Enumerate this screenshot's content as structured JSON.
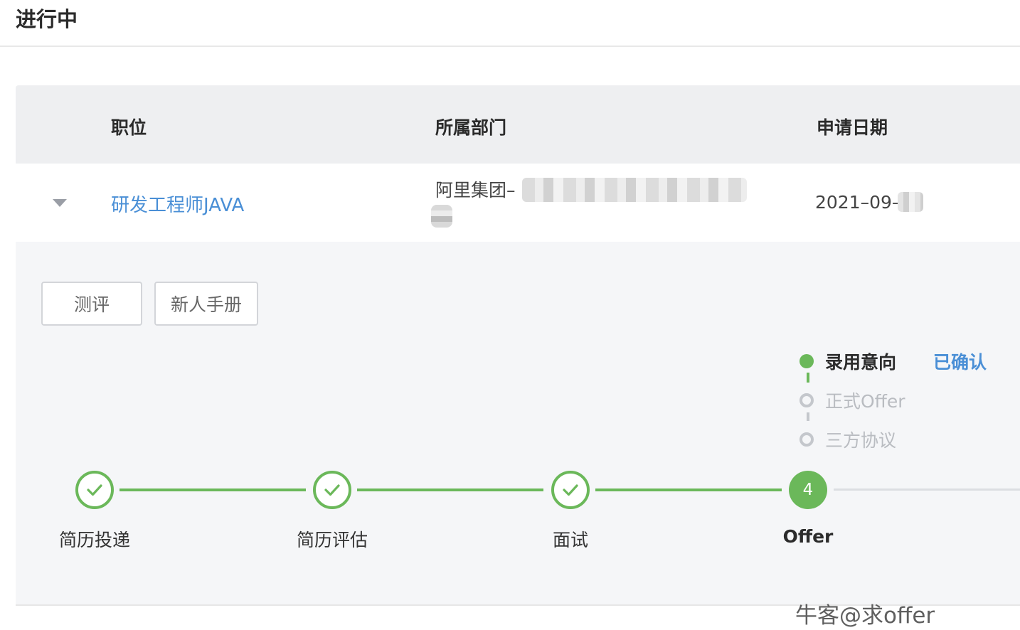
{
  "page": {
    "title": "进行中"
  },
  "table": {
    "headers": {
      "position": "职位",
      "department": "所属部门",
      "date": "申请日期"
    },
    "row": {
      "position": "研发工程师JAVA",
      "department": "阿里集团–",
      "date": "2021–09–"
    }
  },
  "detail": {
    "buttons": {
      "evaluation": "测评",
      "handbook": "新人手册"
    },
    "offer_substeps": [
      {
        "label": "录用意向",
        "state": "done"
      },
      {
        "label": "正式Offer",
        "state": "todo"
      },
      {
        "label": "三方协议",
        "state": "todo"
      }
    ],
    "offer_substep_status": "已确认",
    "steps": [
      {
        "label": "简历投递",
        "state": "done"
      },
      {
        "label": "简历评估",
        "state": "done"
      },
      {
        "label": "面试",
        "state": "done"
      },
      {
        "label": "Offer",
        "state": "current",
        "number": "4"
      }
    ]
  },
  "watermark": "牛客@求offer",
  "colors": {
    "accent_green": "#6bb85a",
    "link_blue": "#4a8fd6",
    "header_bg": "#eeeff1",
    "panel_bg": "#f5f6f8"
  }
}
